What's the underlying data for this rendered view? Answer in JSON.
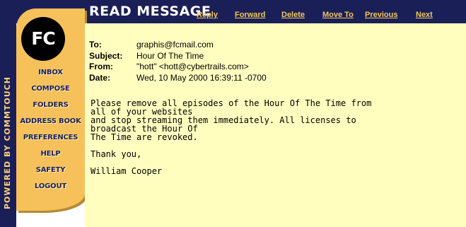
{
  "page": {
    "title": "READ MESSAGE"
  },
  "brand": {
    "logo": "FC",
    "powered_by": "POWERED BY COMMTOUCH"
  },
  "actions": [
    "Reply",
    "Forward",
    "Delete",
    "Move To",
    "Previous",
    "Next"
  ],
  "nav": [
    "INBOX",
    "COMPOSE",
    "FOLDERS",
    "ADDRESS BOOK",
    "PREFERENCES",
    "HELP",
    "SAFETY",
    "LOGOUT"
  ],
  "message": {
    "to_label": "To:",
    "to": "graphis@fcmail.com",
    "subject_label": "Subject:",
    "subject": "Hour Of The Time",
    "from_label": "From:",
    "from": "\"hott\" <hott@cybertrails.com>",
    "date_label": "Date:",
    "date": "Wed, 10 May 2000 16:39:11 -0700",
    "body": "Please remove all episodes of the Hour Of The Time from\nall of your websites\nand stop streaming them immediately. All licenses to\nbroadcast the Hour Of\nThe Time are revoked.\n\nThank you,\n\nWilliam Cooper"
  },
  "colors": {
    "navy": "#1b1f57",
    "panel": "#f6c15a",
    "content_bg": "#fffebf",
    "link": "#f2c95a"
  }
}
